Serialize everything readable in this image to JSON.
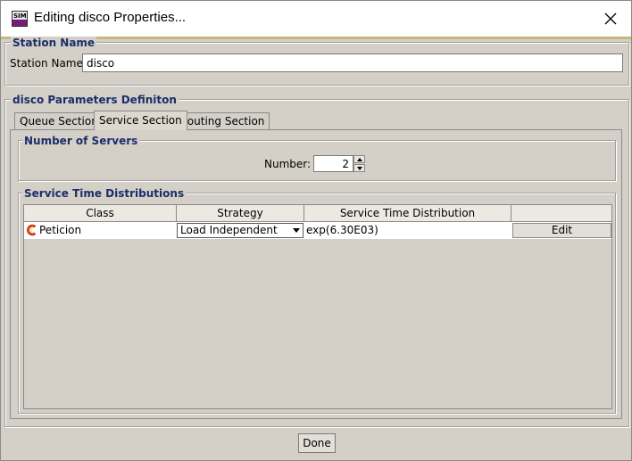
{
  "window": {
    "title": "Editing disco Properties...",
    "app_icon_label": "SIM",
    "close_icon": "close-x-icon"
  },
  "station": {
    "group_title": "Station Name",
    "label": "Station Name:",
    "value": "disco"
  },
  "parameters": {
    "group_title": "disco Parameters Definiton",
    "tabs": [
      {
        "label": "Queue Section",
        "active": false
      },
      {
        "label": "Service Section",
        "active": true
      },
      {
        "label": "Routing Section",
        "active": false
      }
    ]
  },
  "servers": {
    "group_title": "Number of Servers",
    "label": "Number:",
    "value": "2"
  },
  "distributions": {
    "group_title": "Service Time Distributions",
    "columns": [
      "Class",
      "Strategy",
      "Service Time Distribution",
      ""
    ],
    "rows": [
      {
        "class_icon": "closed-class-icon",
        "class": "Peticion",
        "strategy": "Load Independent",
        "distribution": "exp(6.30E03)",
        "action": "Edit"
      }
    ]
  },
  "footer": {
    "done_label": "Done"
  },
  "colors": {
    "group_title": "#1a2f6a",
    "panel_bg": "#d4d0c8",
    "class_icon_red": "#d42a1a",
    "class_icon_yellow": "#f0c020"
  }
}
